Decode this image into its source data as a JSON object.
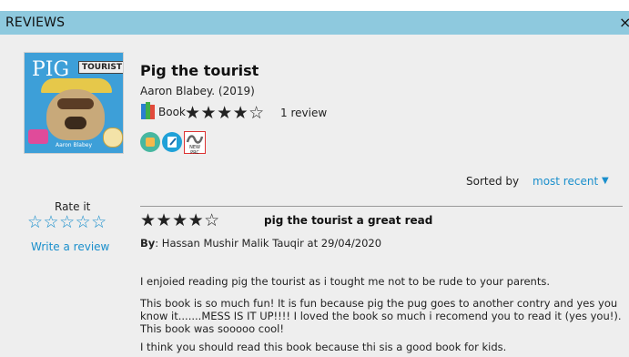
{
  "header": {
    "title": "REVIEWS",
    "close_label": "×"
  },
  "book": {
    "cover": {
      "title_word": "PIG",
      "tourist_word": "TOURIST",
      "author": "Aaron Blabey"
    },
    "title": "Pig the tourist",
    "author_year": "Aaron Blabey. (2019)",
    "format": "Book",
    "rating_stars": "★★★★☆",
    "rating_value": 4,
    "review_count": "1 review",
    "badges": [
      "books-icon",
      "pencil-icon",
      "new-prc-icon"
    ],
    "badge_c_label": "NEW PRC"
  },
  "sort": {
    "label": "Sorted by",
    "value": "most recent",
    "caret": "▼"
  },
  "rate": {
    "label": "Rate it",
    "stars": "☆☆☆☆☆",
    "write_label": "Write a review"
  },
  "review": {
    "stars": "★★★★☆",
    "rating_value": 4,
    "title": "pig the tourist a great read",
    "by_label": "By",
    "by_text": ": Hassan Mushir Malik Tauqir at 29/04/2020",
    "paragraphs": [
      "I enjoied reading pig the tourist as i tought me not to be rude to your parents.",
      "This book is so much fun! It is fun because pig the pug goes to another contry and yes you know it.......MESS IS IT UP!!!! I loved the book so much i recomend you to read it (yes you!). This book was sooooo cool!",
      "I think you should read this book because thi sis a good book for kids."
    ]
  },
  "colors": {
    "header_bg": "#8ec9de",
    "link": "#1a8fcc",
    "panel_bg": "#eeeeee"
  }
}
